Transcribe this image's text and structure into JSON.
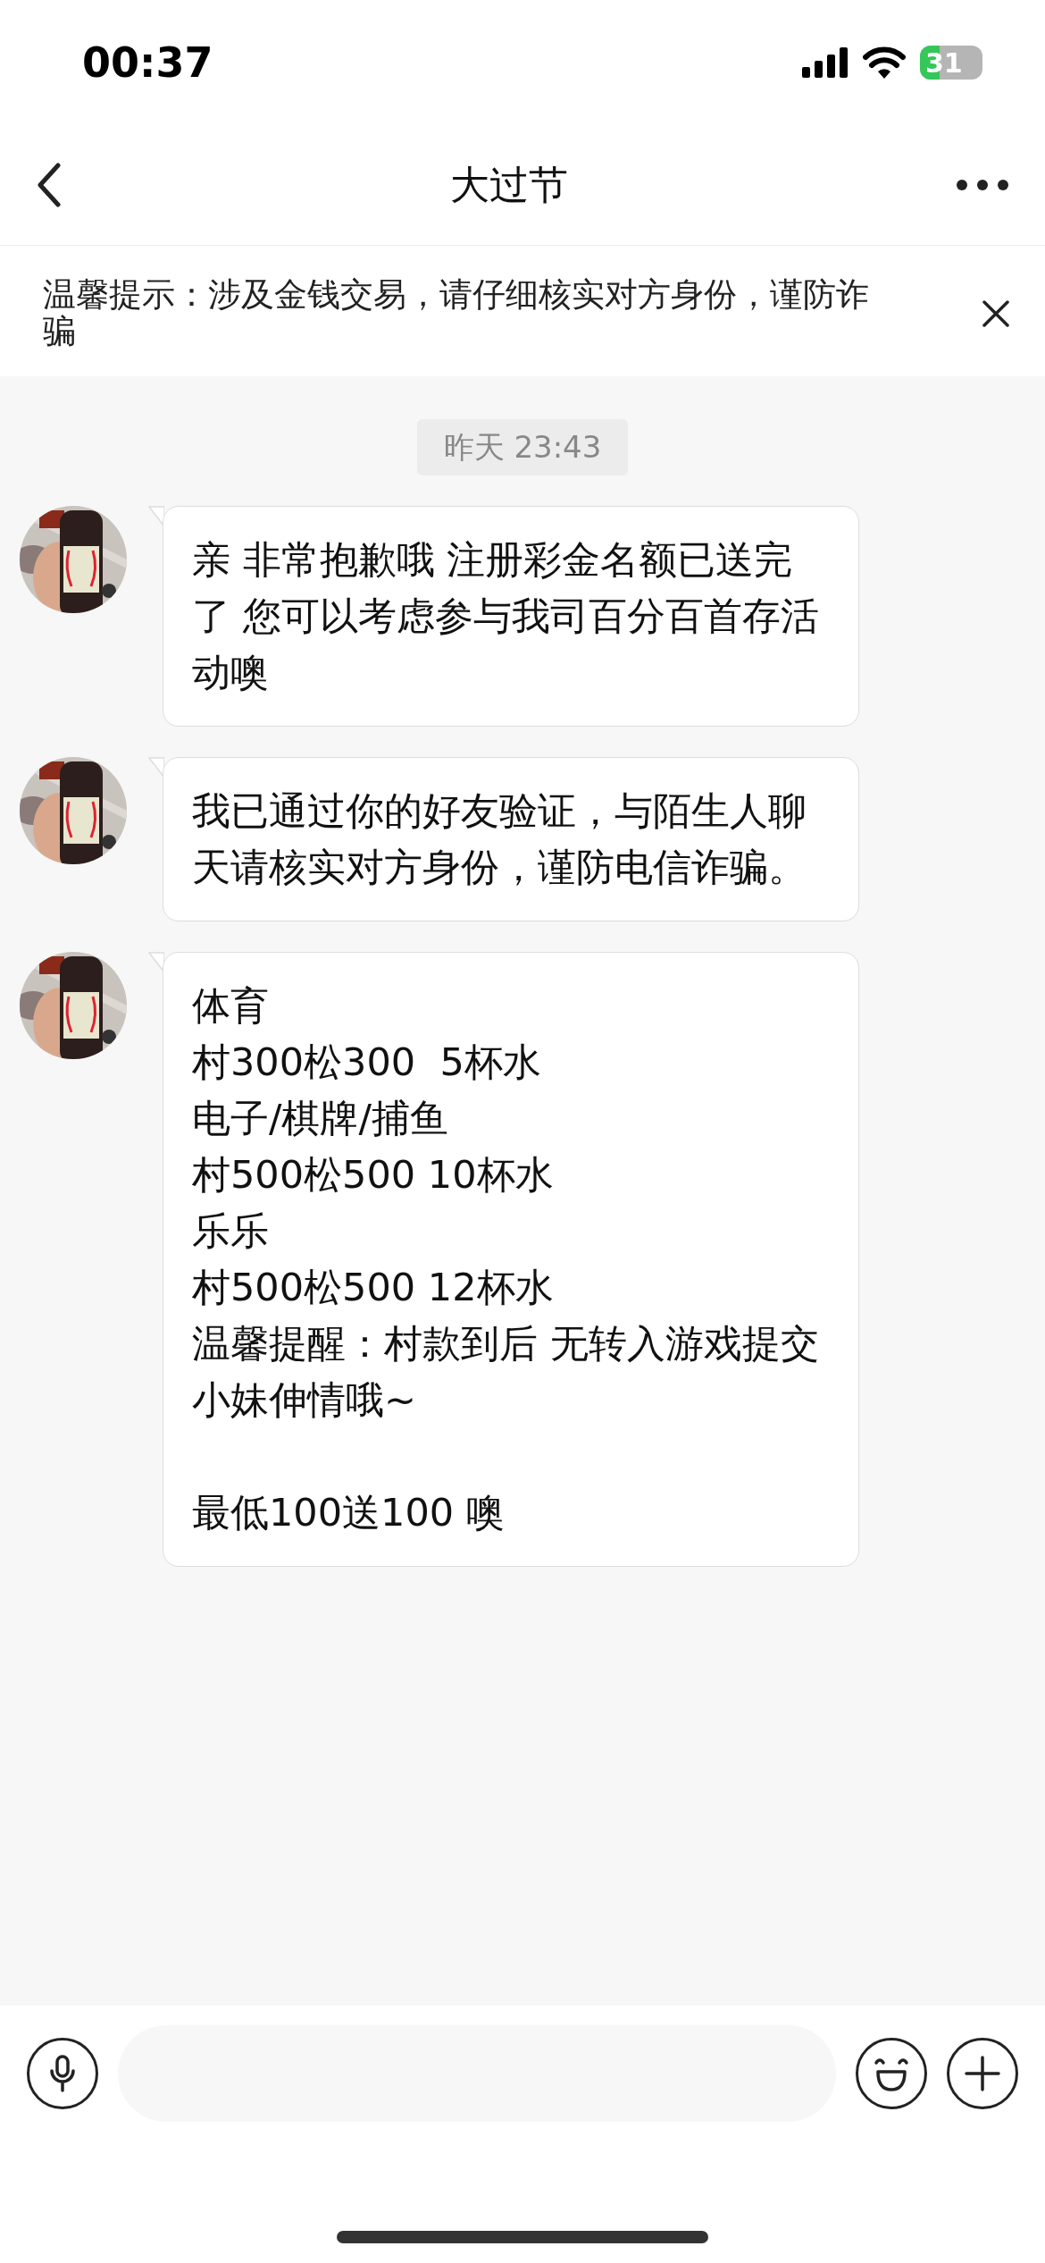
{
  "status_bar": {
    "time": "00:37",
    "battery": "31"
  },
  "header": {
    "title": "大过节"
  },
  "notice": {
    "text": "温馨提示：涉及金钱交易，请仔细核实对方身份，谨防诈骗"
  },
  "messages": [
    {
      "kind": "timestamp",
      "text": "昨天 23:43"
    },
    {
      "kind": "incoming",
      "paragraphs": [
        [
          "亲 非常抱歉哦 注册彩金名额已送完了 您可以考虑参与我司百分百首存活动噢"
        ]
      ]
    },
    {
      "kind": "incoming",
      "paragraphs": [
        [
          "我已通过你的好友验证，与陌生人聊天请核实对方身份，谨防电信诈骗。"
        ]
      ]
    },
    {
      "kind": "incoming",
      "paragraphs": [
        [
          "体育",
          "村300松300  5杯水",
          "电子/棋牌/捕鱼",
          "村500松500 10杯水",
          "乐乐",
          "村500松500 12杯水",
          "温馨提醒：村款到后 无转入游戏提交小妹伸情哦~"
        ],
        [
          "最低100送100 噢"
        ]
      ]
    }
  ]
}
